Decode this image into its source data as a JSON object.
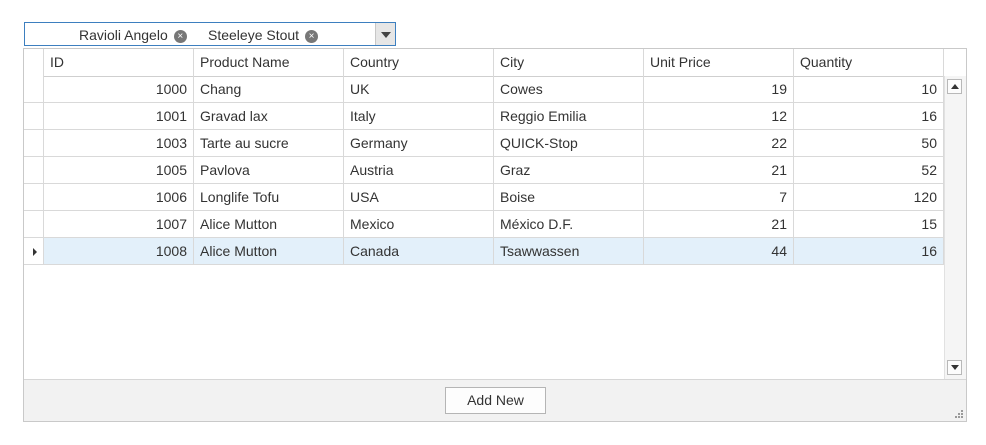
{
  "filter": {
    "tokens": [
      {
        "label": "Ravioli Angelo"
      },
      {
        "label": "Steeleye Stout"
      }
    ],
    "remove_glyph": "×"
  },
  "grid": {
    "columns": [
      "ID",
      "Product Name",
      "Country",
      "City",
      "Unit Price",
      "Quantity"
    ],
    "rows": [
      {
        "id": "1000",
        "product": "Chang",
        "country": "UK",
        "city": "Cowes",
        "price": "19",
        "qty": "10"
      },
      {
        "id": "1001",
        "product": "Gravad lax",
        "country": "Italy",
        "city": "Reggio Emilia",
        "price": "12",
        "qty": "16"
      },
      {
        "id": "1003",
        "product": "Tarte au sucre",
        "country": "Germany",
        "city": "QUICK-Stop",
        "price": "22",
        "qty": "50"
      },
      {
        "id": "1005",
        "product": "Pavlova",
        "country": "Austria",
        "city": "Graz",
        "price": "21",
        "qty": "52"
      },
      {
        "id": "1006",
        "product": "Longlife Tofu",
        "country": "USA",
        "city": "Boise",
        "price": "7",
        "qty": "120"
      },
      {
        "id": "1007",
        "product": "Alice Mutton",
        "country": "Mexico",
        "city": "México D.F.",
        "price": "21",
        "qty": "15"
      },
      {
        "id": "1008",
        "product": "Alice Mutton",
        "country": "Canada",
        "city": "Tsawwassen",
        "price": "44",
        "qty": "16"
      }
    ],
    "selected_row": 6
  },
  "footer": {
    "add_new_label": "Add New"
  },
  "colors": {
    "accent_border": "#3d7fbf",
    "selected_row": "#e3f0fa"
  }
}
